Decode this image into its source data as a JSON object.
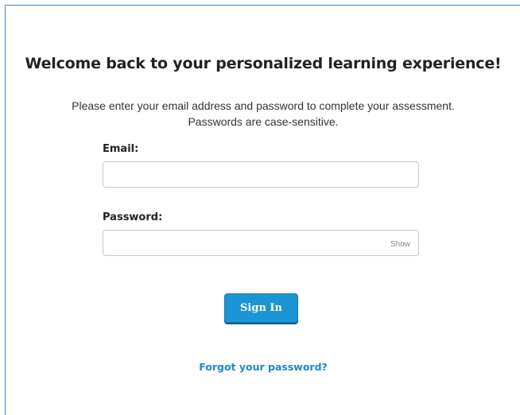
{
  "page": {
    "title": "Welcome back to your personalized learning experience!",
    "subtitle_line1": "Please enter your email address and password to complete your assessment.",
    "subtitle_line2": "Passwords are case-sensitive."
  },
  "form": {
    "email_label": "Email:",
    "email_value": "",
    "email_placeholder": "",
    "password_label": "Password:",
    "password_value": "",
    "password_placeholder": "",
    "show_toggle": "Show",
    "signin_label": "Sign In",
    "forgot_label": "Forgot your password?"
  },
  "colors": {
    "accent": "#1b95d3",
    "link": "#1a8ac6",
    "frame_border": "#4a86c8"
  }
}
